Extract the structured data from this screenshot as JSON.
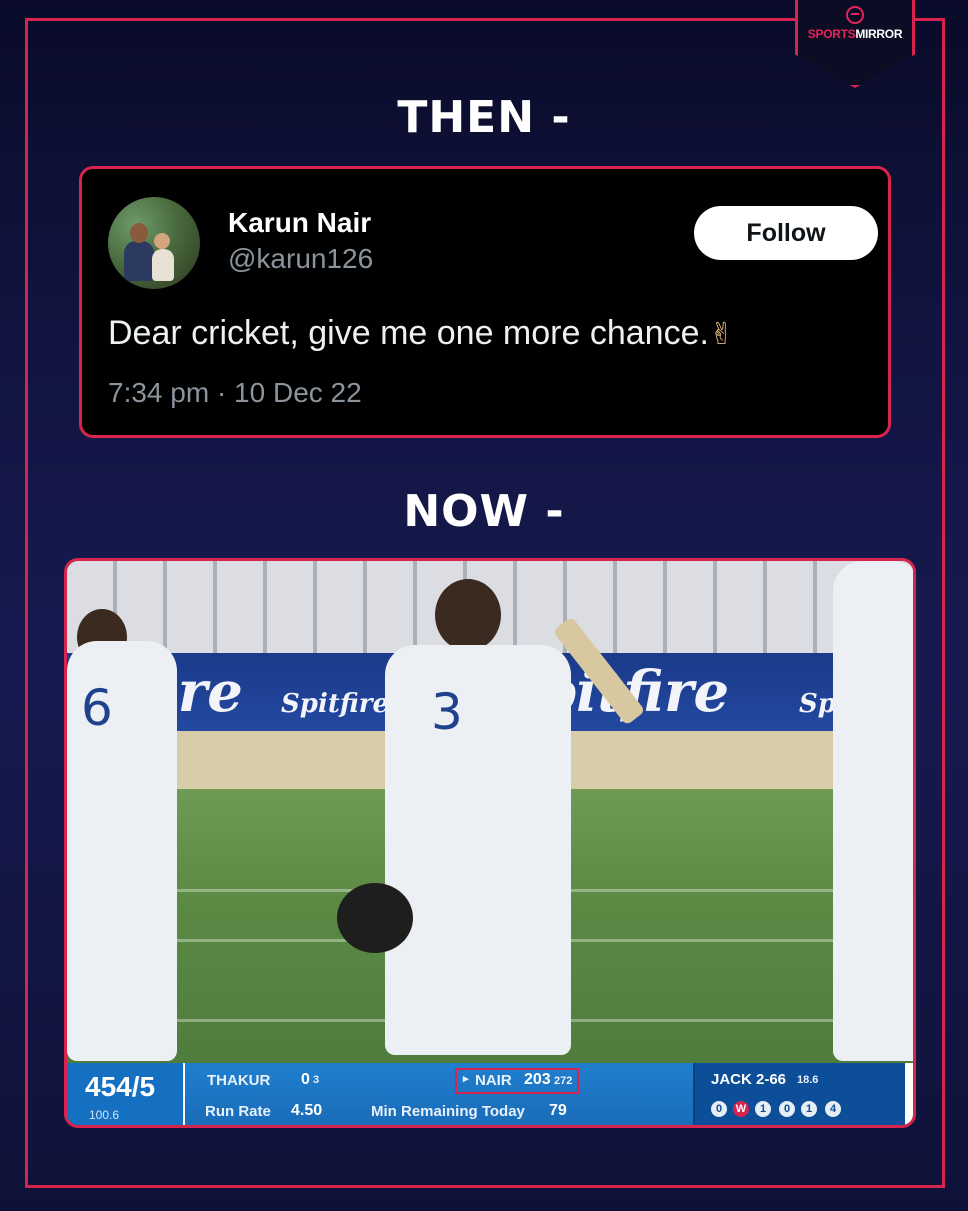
{
  "brand": {
    "part1": "SPORTS",
    "part2": "MIRROR"
  },
  "headings": {
    "then": "THEN -",
    "now": "NOW -"
  },
  "tweet": {
    "name": "Karun Nair",
    "handle": "@karun126",
    "follow_label": "Follow",
    "text": "Dear cricket, give me one more chance.",
    "emoji_icon": "crossed-fingers",
    "time": "7:34 pm · 10 Dec 22"
  },
  "photo": {
    "shirt_numbers": [
      "6",
      "3"
    ],
    "hoardings": [
      "fire",
      "Spitfire",
      "pitfire",
      "Sp"
    ],
    "scorecard": {
      "total": "454/5",
      "overs": "100.6",
      "batter1": "THAKUR",
      "batter1_runs": "0",
      "batter1_balls": "3",
      "batter2": "NAIR",
      "batter2_runs": "203",
      "batter2_balls": "272",
      "run_rate_label": "Run Rate",
      "run_rate": "4.50",
      "min_label": "Min Remaining Today",
      "min_value": "79",
      "bowler": "JACK 2-66",
      "bowler_overs": "18.6",
      "balls": [
        "0",
        "W",
        "1",
        "0",
        "1",
        "4"
      ]
    }
  },
  "colors": {
    "accent": "#d6244f",
    "background": "#121542"
  }
}
